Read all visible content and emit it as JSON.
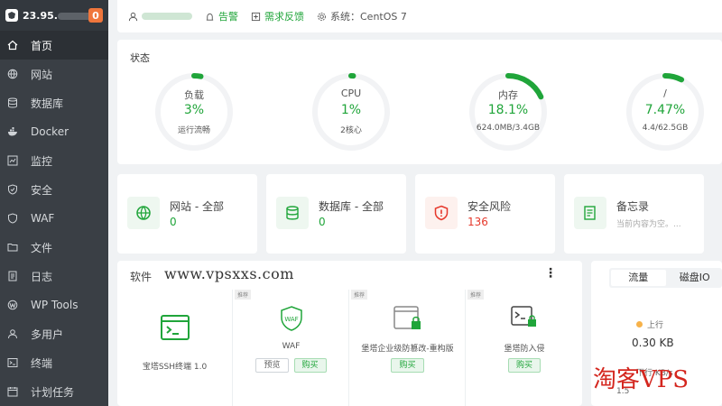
{
  "sidebar": {
    "ip": "23.95.",
    "badge": "0",
    "items": [
      {
        "label": "首页",
        "icon": "home-icon"
      },
      {
        "label": "网站",
        "icon": "globe-icon"
      },
      {
        "label": "数据库",
        "icon": "database-icon"
      },
      {
        "label": "Docker",
        "icon": "docker-icon"
      },
      {
        "label": "监控",
        "icon": "monitor-icon"
      },
      {
        "label": "安全",
        "icon": "shield-icon"
      },
      {
        "label": "WAF",
        "icon": "waf-shield-icon"
      },
      {
        "label": "文件",
        "icon": "folder-icon"
      },
      {
        "label": "日志",
        "icon": "log-icon"
      },
      {
        "label": "WP Tools",
        "icon": "wordpress-icon"
      },
      {
        "label": "多用户",
        "icon": "users-icon"
      },
      {
        "label": "终端",
        "icon": "terminal-icon"
      },
      {
        "label": "计划任务",
        "icon": "calendar-icon"
      }
    ]
  },
  "topbar": {
    "alarm": "告警",
    "feedback": "需求反馈",
    "system": "系统：CentOS 7"
  },
  "status": {
    "title": "状态",
    "gauges": [
      {
        "label": "负载",
        "value": "3%",
        "sub": "运行流畅",
        "percent": 3
      },
      {
        "label": "CPU",
        "value": "1%",
        "sub": "2核心",
        "percent": 1
      },
      {
        "label": "内存",
        "value": "18.1%",
        "sub": "624.0MB/3.4GB",
        "percent": 18.1
      },
      {
        "label": "/",
        "value": "7.47%",
        "sub": "4.4/62.5GB",
        "percent": 7.47
      }
    ]
  },
  "summary": {
    "site": {
      "title": "网站 - 全部",
      "value": "0"
    },
    "db": {
      "title": "数据库 - 全部",
      "value": "0"
    },
    "risk": {
      "title": "安全风险",
      "value": "136"
    },
    "memo": {
      "title": "备忘录",
      "sub": "当前内容为空。..."
    }
  },
  "software": {
    "title": "软件",
    "watermark": "www.vpsxxs.com",
    "rec": "推荐",
    "apps": [
      {
        "name": "宝塔SSH终端 1.0"
      },
      {
        "name": "WAF",
        "preview": "预览",
        "buy": "购买"
      },
      {
        "name": "堡塔企业级防篡改-重构版",
        "buy": "购买"
      },
      {
        "name": "堡塔防入侵",
        "buy": "购买"
      }
    ]
  },
  "traffic": {
    "tab_flow": "流量",
    "tab_disk": "磁盘IO",
    "up_label": "上行",
    "up_value": "0.30 KB",
    "down_label": "下行 KB/s",
    "down_value": "1.5"
  },
  "watermark_bottom": "淘客VPS",
  "colors": {
    "accent": "#20a53a",
    "danger": "#e6382b",
    "sidebar": "#3a3f45"
  }
}
